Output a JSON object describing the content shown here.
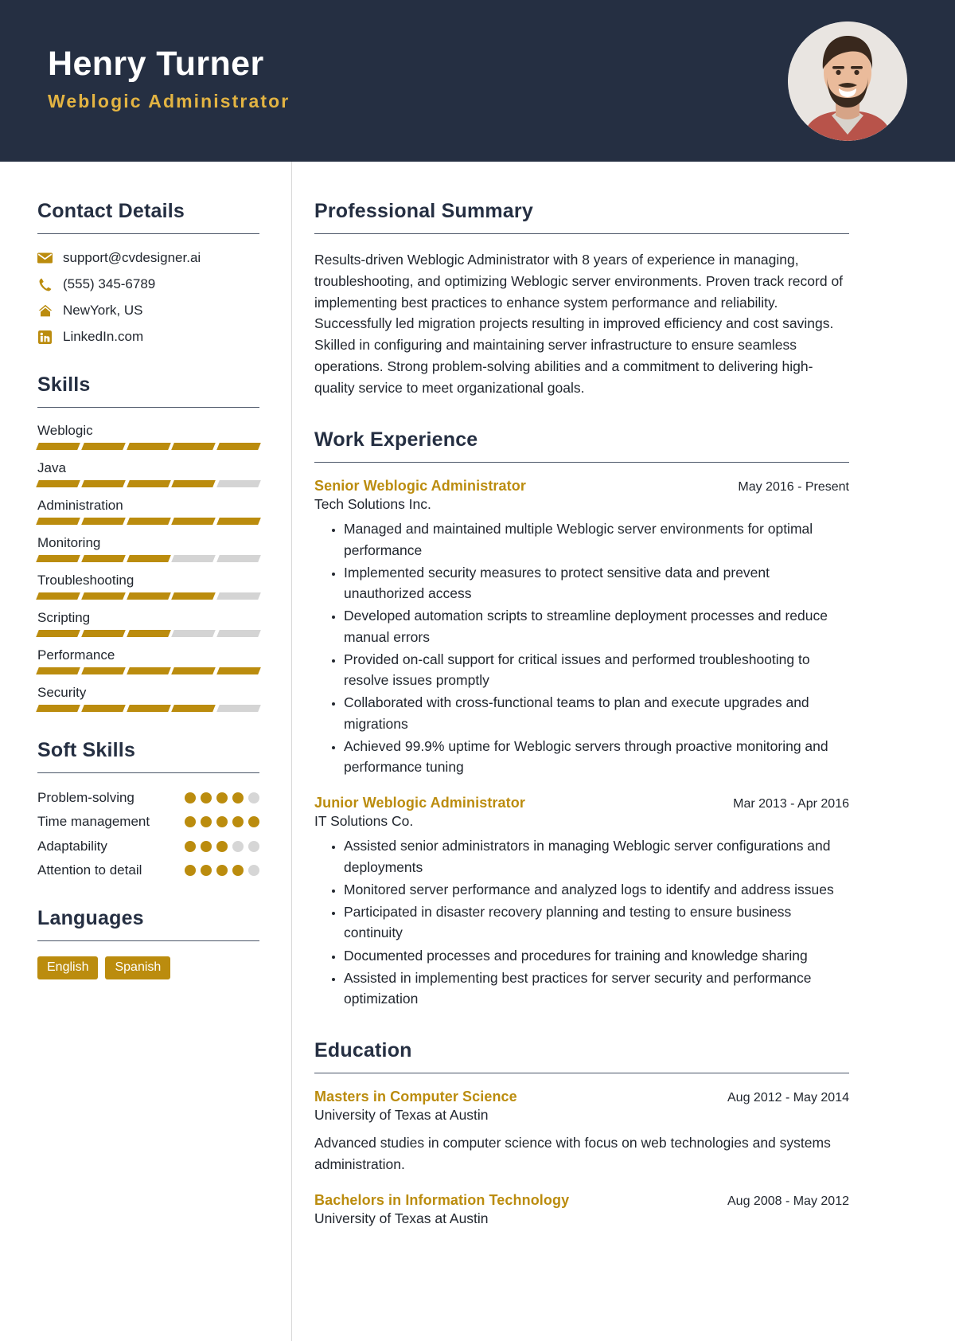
{
  "theme": {
    "header_bg": "#252f42",
    "accent": "#bb8c0e",
    "header_accent": "#e3b442",
    "text": "#22272f",
    "bar_empty": "#d4d4d4"
  },
  "header": {
    "full_name": "Henry Turner",
    "job_title": "Weblogic Administrator",
    "avatar_alt": "profile-photo"
  },
  "sidebar": {
    "contact": {
      "title": "Contact Details",
      "items": [
        {
          "icon": "envelope-icon",
          "value": "support@cvdesigner.ai"
        },
        {
          "icon": "phone-icon",
          "value": "(555) 345-6789"
        },
        {
          "icon": "home-icon",
          "value": "NewYork, US"
        },
        {
          "icon": "linkedin-icon",
          "value": "LinkedIn.com"
        }
      ]
    },
    "skills": {
      "title": "Skills",
      "max": 5,
      "items": [
        {
          "name": "Weblogic",
          "level": 5
        },
        {
          "name": "Java",
          "level": 4
        },
        {
          "name": "Administration",
          "level": 5
        },
        {
          "name": "Monitoring",
          "level": 3
        },
        {
          "name": "Troubleshooting",
          "level": 4
        },
        {
          "name": "Scripting",
          "level": 3
        },
        {
          "name": "Performance",
          "level": 5
        },
        {
          "name": "Security",
          "level": 4
        }
      ]
    },
    "soft_skills": {
      "title": "Soft Skills",
      "max": 5,
      "items": [
        {
          "name": "Problem-solving",
          "level": 4
        },
        {
          "name": "Time management",
          "level": 5
        },
        {
          "name": "Adaptability",
          "level": 3
        },
        {
          "name": "Attention to detail",
          "level": 4
        }
      ]
    },
    "languages": {
      "title": "Languages",
      "items": [
        "English",
        "Spanish"
      ]
    }
  },
  "main": {
    "summary": {
      "title": "Professional Summary",
      "text": "Results-driven Weblogic Administrator with 8 years of experience in managing, troubleshooting, and optimizing Weblogic server environments. Proven track record of implementing best practices to enhance system performance and reliability. Successfully led migration projects resulting in improved efficiency and cost savings. Skilled in configuring and maintaining server infrastructure to ensure seamless operations. Strong problem-solving abilities and a commitment to delivering high-quality service to meet organizational goals."
    },
    "work": {
      "title": "Work Experience",
      "entries": [
        {
          "role": "Senior Weblogic Administrator",
          "date": "May 2016 - Present",
          "company": "Tech Solutions Inc.",
          "bullets": [
            "Managed and maintained multiple Weblogic server environments for optimal performance",
            "Implemented security measures to protect sensitive data and prevent unauthorized access",
            "Developed automation scripts to streamline deployment processes and reduce manual errors",
            "Provided on-call support for critical issues and performed troubleshooting to resolve issues promptly",
            "Collaborated with cross-functional teams to plan and execute upgrades and migrations",
            "Achieved 99.9% uptime for Weblogic servers through proactive monitoring and performance tuning"
          ]
        },
        {
          "role": "Junior Weblogic Administrator",
          "date": "Mar 2013 - Apr 2016",
          "company": "IT Solutions Co.",
          "bullets": [
            "Assisted senior administrators in managing Weblogic server configurations and deployments",
            "Monitored server performance and analyzed logs to identify and address issues",
            "Participated in disaster recovery planning and testing to ensure business continuity",
            "Documented processes and procedures for training and knowledge sharing",
            "Assisted in implementing best practices for server security and performance optimization"
          ]
        }
      ]
    },
    "education": {
      "title": "Education",
      "entries": [
        {
          "degree": "Masters in Computer Science",
          "date": "Aug 2012 - May 2014",
          "school": "University of Texas at Austin",
          "desc": "Advanced studies in computer science with focus on web technologies and systems administration."
        },
        {
          "degree": "Bachelors in Information Technology",
          "date": "Aug 2008 - May 2012",
          "school": "University of Texas at Austin",
          "desc": ""
        }
      ]
    }
  }
}
